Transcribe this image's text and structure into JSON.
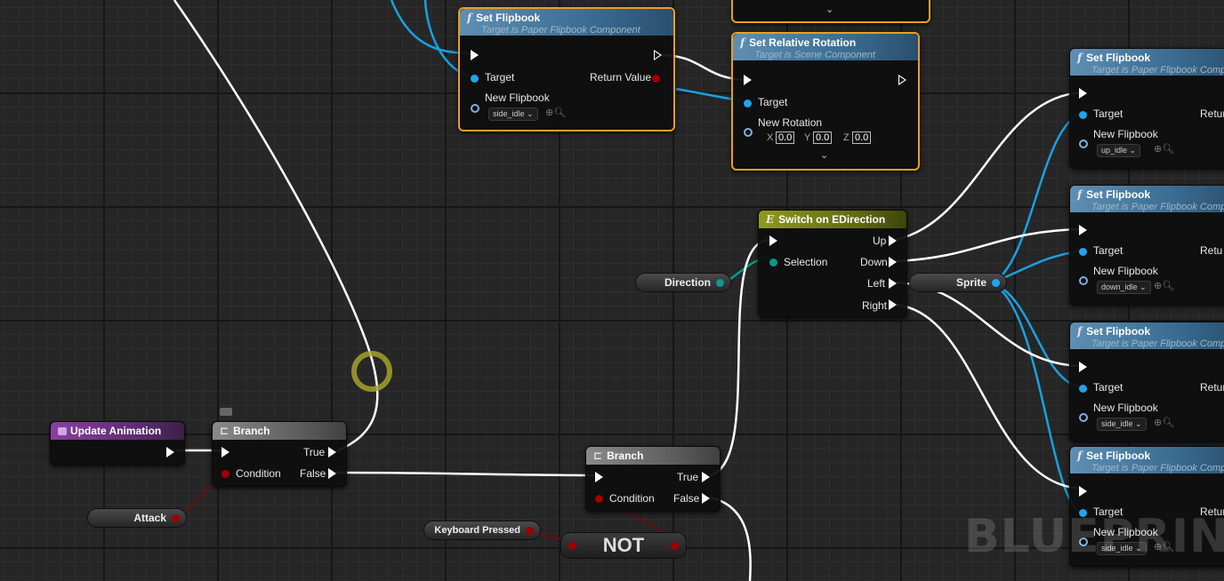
{
  "nodes": {
    "set_flipbook_top": {
      "title": "Set Flipbook",
      "subtitle": "Target is Paper Flipbook Component",
      "target": "Target",
      "return": "Return Value",
      "new_flipbook": "New Flipbook",
      "flipbook_value": "side_idle"
    },
    "set_relative_rotation": {
      "title": "Set Relative Rotation",
      "subtitle": "Target is Scene Component",
      "target": "Target",
      "new_rotation": "New Rotation",
      "x_label": "X",
      "x": "0.0",
      "y_label": "Y",
      "y": "0.0",
      "z_label": "Z",
      "z": "0.0"
    },
    "switch": {
      "title": "Switch on EDirection",
      "selection": "Selection",
      "up": "Up",
      "down": "Down",
      "left": "Left",
      "right": "Right"
    },
    "direction_var": {
      "label": "Direction"
    },
    "sprite_var": {
      "label": "Sprite"
    },
    "update_animation": {
      "title": "Update Animation"
    },
    "branch1": {
      "title": "Branch",
      "true": "True",
      "false": "False",
      "condition": "Condition"
    },
    "branch2": {
      "title": "Branch",
      "true": "True",
      "false": "False",
      "condition": "Condition"
    },
    "attack_var": {
      "label": "Attack"
    },
    "keyboard_var": {
      "label": "Keyboard Pressed"
    },
    "not_node": {
      "label": "NOT"
    },
    "right_flipbooks": [
      {
        "title": "Set Flipbook",
        "subtitle": "Target is Paper Flipbook Comp",
        "target": "Target",
        "return": "Retur",
        "new_flipbook": "New Flipbook",
        "flipbook_value": "up_idle"
      },
      {
        "title": "Set Flipbook",
        "subtitle": "Target is Paper Flipbook Comp",
        "target": "Target",
        "return": "Retu",
        "new_flipbook": "New Flipbook",
        "flipbook_value": "down_idle"
      },
      {
        "title": "Set Flipbook",
        "subtitle": "Target is Paper Flipbook Comp",
        "target": "Target",
        "return": "Retur",
        "new_flipbook": "New Flipbook",
        "flipbook_value": "side_idle"
      },
      {
        "title": "Set Flipbook",
        "subtitle": "Target is Paper Flipbook Comp",
        "target": "Target",
        "return": "Retur",
        "new_flipbook": "New Flipbook",
        "flipbook_value": "side_idle"
      }
    ]
  },
  "watermark": "BLUEPRINT",
  "colors": {
    "exec_wire": "#ffffff",
    "object_wire": "#1aa0e0",
    "bool_wire": "#a00000",
    "selection_border": "#e8a020",
    "function_header": "#3b6d93"
  }
}
